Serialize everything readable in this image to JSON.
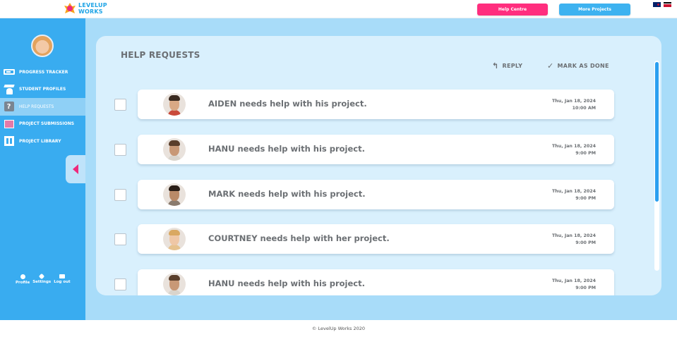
{
  "topbar": {
    "logo_line1": "LEVELUP",
    "logo_line2": "WORKS",
    "help_centre": "Help Centre",
    "more_projects": "More Projects"
  },
  "sidebar": {
    "items": [
      {
        "label": "PROGRESS TRACKER",
        "icon": "progress-tracker-icon"
      },
      {
        "label": "STUDENT PROFILES",
        "icon": "student-profiles-icon"
      },
      {
        "label": "HELP REQUESTS",
        "icon": "help-requests-icon",
        "active": true
      },
      {
        "label": "PROJECT SUBMISSIONS",
        "icon": "project-submissions-icon"
      },
      {
        "label": "PROJECT LIBRARY",
        "icon": "project-library-icon"
      }
    ],
    "bottom": {
      "profile": "Profile",
      "settings": "Settings",
      "logout": "Log out"
    }
  },
  "main": {
    "title": "HELP REQUESTS",
    "reply_label": "REPLY",
    "done_label": "MARK AS DONE",
    "requests": [
      {
        "message": "AIDEN needs help with his project.",
        "date": "Thu, Jan 18, 2024",
        "time": "10:00 AM"
      },
      {
        "message": "HANU needs help with his project.",
        "date": "Thu, Jan 18, 2024",
        "time": "9:00 PM"
      },
      {
        "message": "MARK needs help with his project.",
        "date": "Thu, Jan 18, 2024",
        "time": "9:00 PM"
      },
      {
        "message": "COURTNEY needs help with her project.",
        "date": "Thu, Jan 18, 2024",
        "time": "9:00 PM"
      },
      {
        "message": "HANU needs help with his project.",
        "date": "Thu, Jan 18, 2024",
        "time": "9:00 PM"
      }
    ]
  },
  "footer": {
    "copyright": "© LevelUp Works 2020"
  },
  "colors": {
    "sidebar": "#39acf0",
    "main_bg": "#a8dcf9",
    "panel_bg": "#d9f0fd",
    "help_button": "#ff2e7e",
    "more_button": "#3db2f0",
    "accent_pink": "#ee2a7b"
  }
}
